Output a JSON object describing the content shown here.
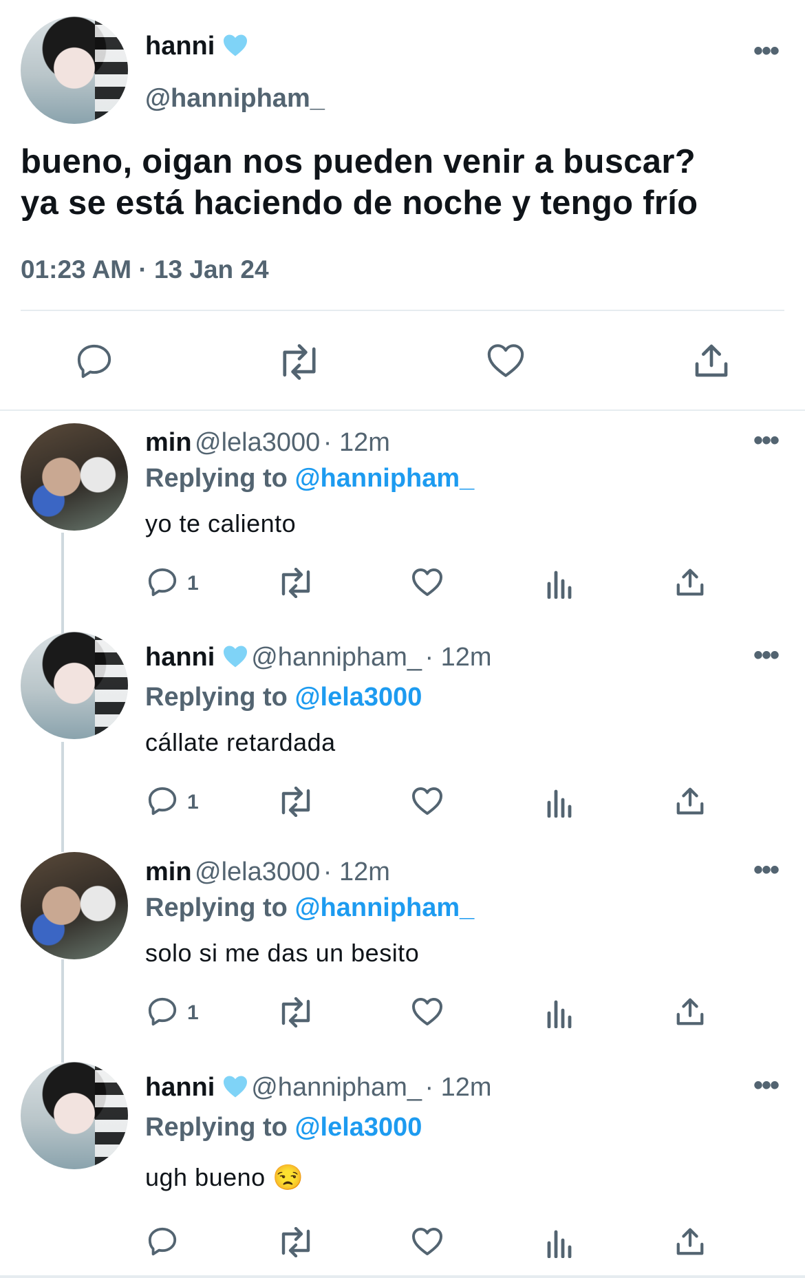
{
  "main_tweet": {
    "display_name": "hanni",
    "handle": "@hannipham_",
    "text_line1": "bueno, oigan nos pueden venir a buscar?",
    "text_line2": "ya se está haciendo de noche y tengo frío",
    "timestamp": "01:23 AM · 13 Jan 24"
  },
  "replies": [
    {
      "display_name": "min",
      "handle": "@lela3000",
      "time": "· 12m",
      "replying_prefix": "Replying to",
      "replying_to": "@hannipham_",
      "text": "yo te caliento",
      "reply_count": "1"
    },
    {
      "display_name": "hanni",
      "handle": "@hannipham_",
      "time": "· 12m",
      "replying_prefix": "Replying to",
      "replying_to": "@lela3000",
      "text": "cállate retardada",
      "reply_count": "1"
    },
    {
      "display_name": "min",
      "handle": "@lela3000",
      "time": "· 12m",
      "replying_prefix": "Replying to",
      "replying_to": "@hannipham_",
      "text": "solo si me das un besito",
      "reply_count": "1"
    },
    {
      "display_name": "hanni",
      "handle": "@hannipham_",
      "time": "· 12m",
      "replying_prefix": "Replying to",
      "replying_to": "@lela3000",
      "text": "ugh bueno 😒",
      "reply_count": ""
    }
  ],
  "more_glyph": "•••",
  "icons": [
    "reply-icon",
    "retweet-icon",
    "like-icon",
    "views-icon",
    "share-icon",
    "more-icon",
    "verified-heart-icon"
  ],
  "colors": {
    "link": "#1d9bf0",
    "muted": "#536471",
    "text": "#0f1419",
    "verified": "#7fd3f7"
  }
}
